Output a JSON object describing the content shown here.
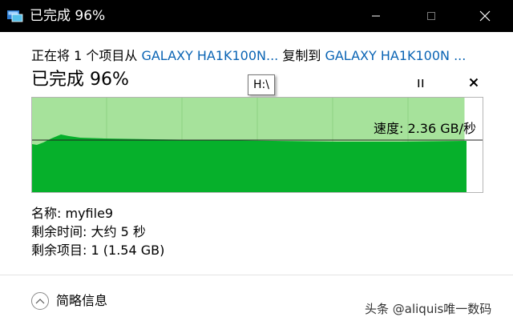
{
  "window": {
    "title": "已完成 96%"
  },
  "copy": {
    "prefix": "正在将 1 个项目从 ",
    "source": "GALAXY HA1K100N...",
    "middle": " 复制到 ",
    "destination": "GALAXY HA1K100N ..."
  },
  "progress": {
    "title": "已完成 96%",
    "percent": 96
  },
  "tooltip": {
    "text": "H:\\"
  },
  "graph": {
    "speed_label": "速度: 2.36 GB/秒",
    "colors": {
      "completed": "#a6e29b",
      "fill": "#06b02b",
      "remaining": "#ffffff",
      "line": "#222222"
    }
  },
  "details": {
    "name_label": "名称:",
    "name_value": "myfile9",
    "time_label": "剩余时间:",
    "time_value": "大约 5 秒",
    "items_label": "剩余项目:",
    "items_value": "1 (1.54 GB)"
  },
  "footer": {
    "less_details": "简略信息"
  },
  "watermark": {
    "text": "头条 @aliquis唯一数码"
  }
}
